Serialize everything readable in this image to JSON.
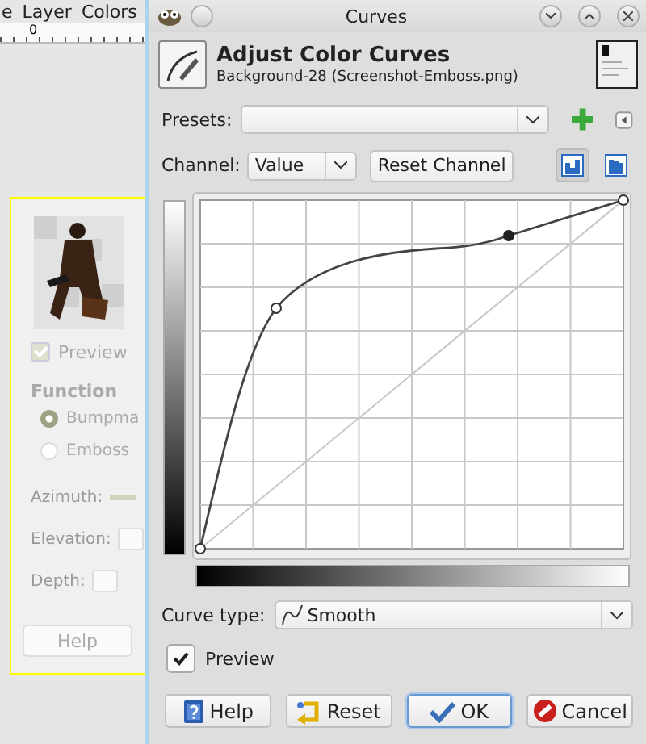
{
  "background_window": {
    "menu": [
      "e",
      "Layer",
      "Colors"
    ],
    "ruler_label": "0",
    "preview": {
      "label": "Preview",
      "checked": true
    },
    "function_heading": "Function",
    "radios": [
      {
        "label": "Bumpma",
        "selected": true
      },
      {
        "label": "Emboss",
        "selected": false
      }
    ],
    "fields": [
      {
        "label": "Azimuth:",
        "kind": "slider"
      },
      {
        "label": "Elevation:",
        "kind": "spin"
      },
      {
        "label": "Depth:",
        "kind": "spin"
      }
    ],
    "help_button": "Help"
  },
  "dialog": {
    "title": "Curves",
    "heading": "Adjust Color Curves",
    "subtitle": "Background-28 (Screenshot-Emboss.png)",
    "presets_label": "Presets:",
    "channel_label": "Channel:",
    "channel_value": "Value",
    "reset_channel_button": "Reset Channel",
    "histogram_scale": [
      {
        "kind": "linear",
        "selected": true
      },
      {
        "kind": "log",
        "selected": false
      }
    ],
    "curve_type_label": "Curve type:",
    "curve_type_value": "Smooth",
    "preview": {
      "label": "Preview",
      "checked": true
    },
    "buttons": [
      {
        "label": "Help",
        "kind": "help",
        "selected": false
      },
      {
        "label": "Reset",
        "kind": "reset",
        "selected": false
      },
      {
        "label": "OK",
        "kind": "ok",
        "selected": true
      },
      {
        "label": "Cancel",
        "kind": "cancel",
        "selected": false
      }
    ]
  }
}
